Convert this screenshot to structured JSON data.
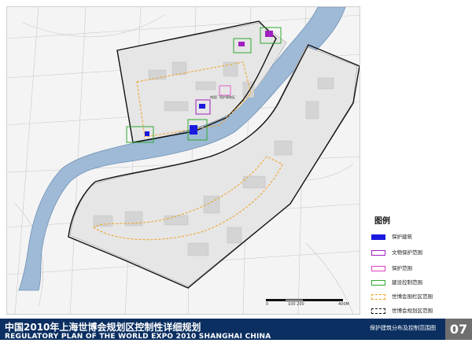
{
  "footer": {
    "title_cn": "中国2010年上海世博会规划区控制性详细规划",
    "title_en": "REGULATORY PLAN OF THE WORLD EXPO 2010 SHANGHAI CHINA",
    "subtitle": "保护建筑分布及控制范围图",
    "page_number": "07"
  },
  "legend": {
    "title": "图例",
    "items": [
      {
        "label": "保护建筑",
        "color": "#1a1adf",
        "style": "solid"
      },
      {
        "label": "文物保护范围",
        "color": "#a020c0",
        "style": "outline"
      },
      {
        "label": "保护范围",
        "color": "#e040c0",
        "style": "outline"
      },
      {
        "label": "建设控制范围",
        "color": "#2ea82e",
        "style": "outline"
      },
      {
        "label": "世博会围栏区范围",
        "color": "#f0a020",
        "style": "dashed"
      },
      {
        "label": "世博会规划区范围",
        "color": "#111111",
        "style": "dashed"
      }
    ]
  },
  "map": {
    "river_color": "#9fbad6",
    "site_label": "南昌厂保护建筑区"
  },
  "scale": {
    "labels": [
      "0",
      "100 200",
      "400M"
    ]
  }
}
